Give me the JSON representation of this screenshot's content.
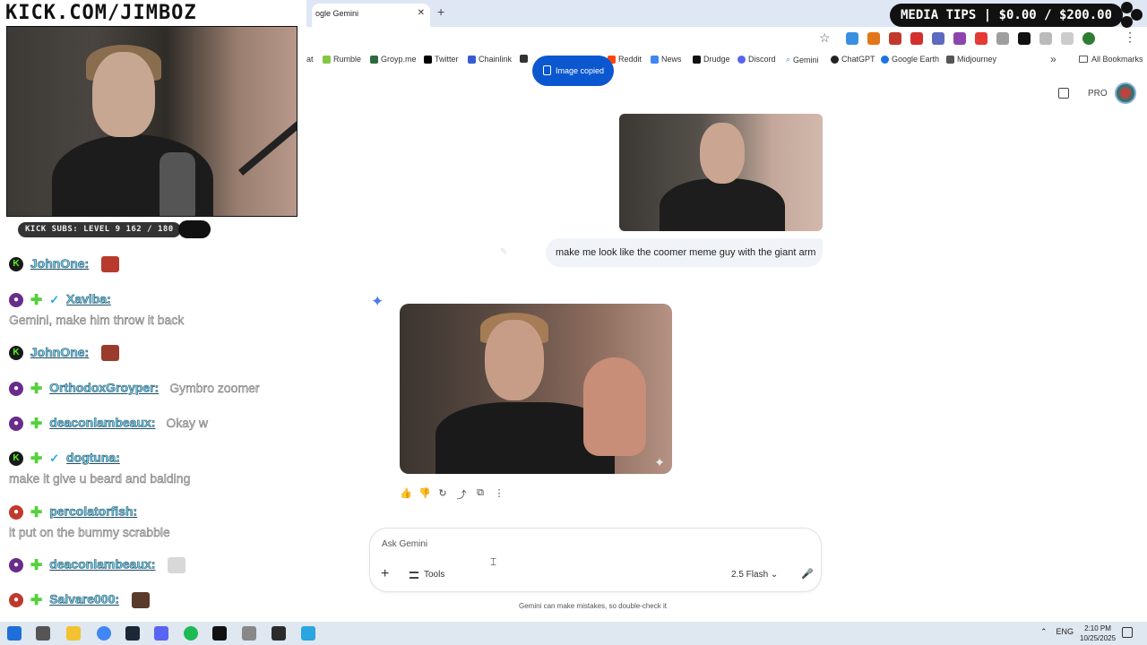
{
  "stream": {
    "title": "KICK.COM/JIMBOZ",
    "subs_badge": "KICK SUBS: LEVEL 9 162 / 180",
    "media_tips": "MEDIA TIPS | $0.00 / $200.00"
  },
  "browser": {
    "tab_title": "Google Gemini",
    "tab_title_visible": "ogle Gemini",
    "bookmarks": [
      {
        "label": "at",
        "color": "#888888"
      },
      {
        "label": "Rumble",
        "color": "#85c742"
      },
      {
        "label": "Groyp.me",
        "color": "#2d6a3e"
      },
      {
        "label": "Twitter",
        "color": "#000000"
      },
      {
        "label": "Chainlink",
        "color": "#375bd2"
      },
      {
        "label": "Reddit",
        "color": "#ff4500"
      },
      {
        "label": "News",
        "color": "#4285f4"
      },
      {
        "label": "Drudge",
        "color": "#111111"
      },
      {
        "label": "Discord",
        "color": "#5865f2"
      },
      {
        "label": "Gemini",
        "color": "#4b7bec"
      },
      {
        "label": "ChatGPT",
        "color": "#222222"
      },
      {
        "label": "Google Earth",
        "color": "#1a73e8"
      },
      {
        "label": "Midjourney",
        "color": "#555555"
      }
    ],
    "all_bookmarks": "All Bookmarks"
  },
  "chat": [
    {
      "user": "JohnOne:",
      "text": "",
      "badges": [
        "kick"
      ],
      "emote": "#b83a2e"
    },
    {
      "user": "Xaviba:",
      "text": "Gemini, make him throw it back",
      "badges": [
        "sub",
        "plus",
        "check"
      ],
      "emote": ""
    },
    {
      "user": "JohnOne:",
      "text": "",
      "badges": [
        "kick"
      ],
      "emote": "#9a3b2d"
    },
    {
      "user": "OrthodoxGroyper:",
      "text": "Gymbro zoomer",
      "badges": [
        "sub",
        "plus"
      ],
      "emote": ""
    },
    {
      "user": "deaconlambeaux:",
      "text": "Okay w",
      "badges": [
        "sub",
        "plus"
      ],
      "emote": ""
    },
    {
      "user": "dogtuna:",
      "text": "make it give u beard and balding",
      "badges": [
        "kick",
        "plus",
        "check"
      ],
      "emote": ""
    },
    {
      "user": "percolatorfish:",
      "text": "it put on the bummy scrabble",
      "badges": [
        "red",
        "plus"
      ],
      "emote": ""
    },
    {
      "user": "deaconlambeaux:",
      "text": "",
      "badges": [
        "sub",
        "plus"
      ],
      "emote": "#d8d8d8"
    },
    {
      "user": "Salvare000:",
      "text": "",
      "badges": [
        "red",
        "plus"
      ],
      "emote": "#5a3a2a"
    }
  ],
  "gemini": {
    "toast": "Image copied",
    "pro": "PRO",
    "user_prompt": "make me look like the coomer meme guy with the giant arm",
    "input_placeholder": "Ask Gemini",
    "tools_label": "Tools",
    "model_label": "2.5 Flash",
    "disclaimer": "Gemini can make mistakes, so double-check it"
  },
  "taskbar": {
    "lang": "ENG",
    "time": "2:10 PM",
    "date": "10/25/2025"
  }
}
